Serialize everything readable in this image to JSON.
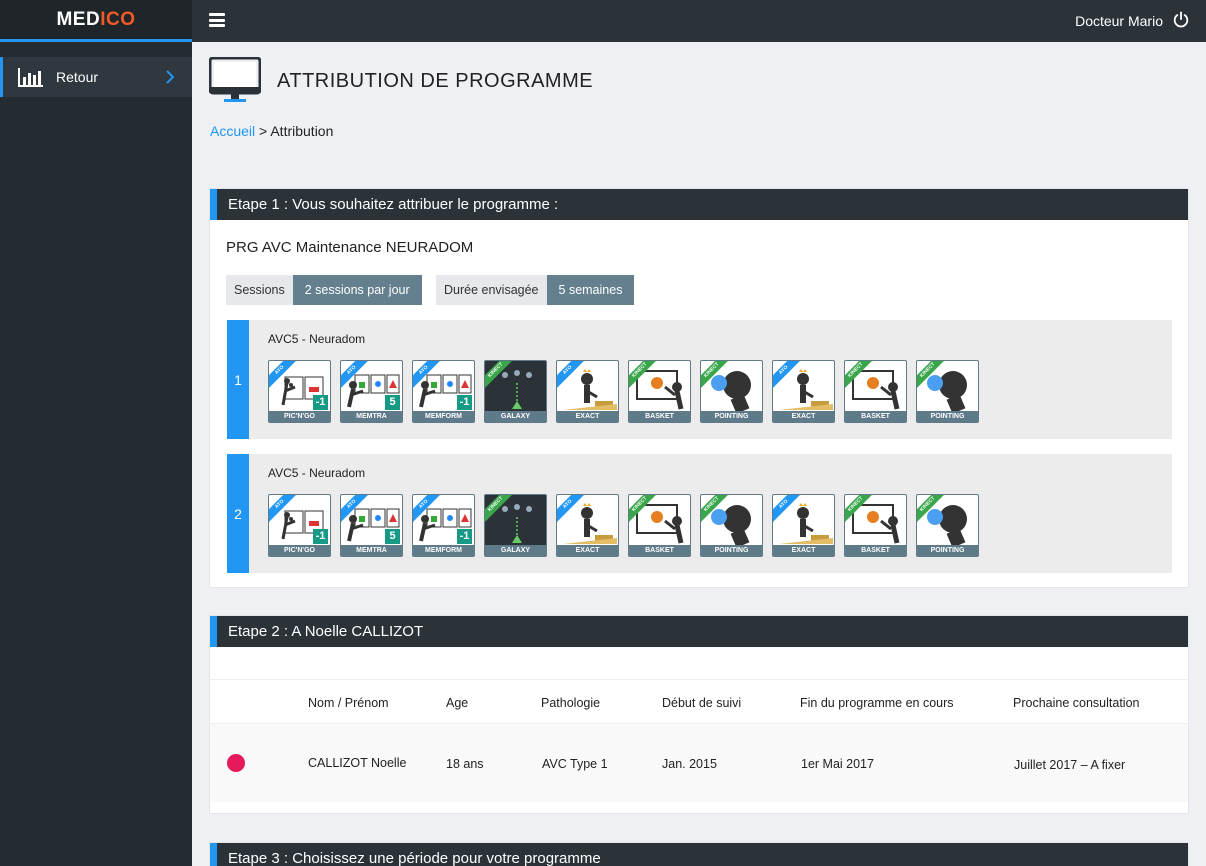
{
  "app": {
    "logo_main": "MED",
    "logo_accent": "ICO"
  },
  "header": {
    "user": "Docteur Mario"
  },
  "sidebar": {
    "items": [
      {
        "label": "Retour"
      }
    ]
  },
  "page": {
    "title": "ATTRIBUTION DE PROGRAMME",
    "breadcrumb": {
      "home": "Accueil",
      "separator": ">",
      "current": "Attribution"
    }
  },
  "step1": {
    "title": "Etape 1 : Vous souhaitez attribuer le programme :",
    "program_name": "PRG AVC  Maintenance NEURADOM",
    "sessions_label": "Sessions",
    "sessions_value": "2 sessions par jour",
    "duration_label": "Durée envisagée",
    "duration_value": "5 semaines",
    "sessions": [
      {
        "number": "1",
        "title": "AVC5 - Neuradom"
      },
      {
        "number": "2",
        "title": "AVC5 - Neuradom"
      }
    ],
    "activities": [
      {
        "name": "PIC'N'GO",
        "tag": "AYO",
        "badge": "-1",
        "icon": "picngo-icon"
      },
      {
        "name": "MEMTRA",
        "tag": "AYO",
        "badge": "5",
        "icon": "memtra-icon"
      },
      {
        "name": "MEMFORM",
        "tag": "AYO",
        "badge": "-1",
        "icon": "memform-icon"
      },
      {
        "name": "GALAXY",
        "tag": "KINECT",
        "badge": "",
        "icon": "galaxy-icon"
      },
      {
        "name": "EXACT",
        "tag": "AYO",
        "badge": "",
        "icon": "exact-icon"
      },
      {
        "name": "BASKET",
        "tag": "KINECT",
        "badge": "",
        "icon": "basket-icon"
      },
      {
        "name": "POINTING",
        "tag": "KINECT",
        "badge": "",
        "icon": "pointing-icon"
      },
      {
        "name": "EXACT",
        "tag": "AYO",
        "badge": "",
        "icon": "exact-icon"
      },
      {
        "name": "BASKET",
        "tag": "KINECT",
        "badge": "",
        "icon": "basket-icon"
      },
      {
        "name": "POINTING",
        "tag": "KINECT",
        "badge": "",
        "icon": "pointing-icon"
      }
    ]
  },
  "step2": {
    "title": "Etape 2 : A Noelle CALLIZOT",
    "columns": [
      "Nom / Prénom",
      "Age",
      "Pathologie",
      "Début de suivi",
      "Fin du programme en cours",
      "Prochaine consultation"
    ],
    "row": [
      "CALLIZOT Noelle",
      "18 ans",
      "AVC Type 1",
      "Jan. 2015",
      "1er Mai 2017",
      "Juillet 2017 – A fixer"
    ],
    "status_color": "#e6195a"
  },
  "step3": {
    "title": "Etape 3 : Choisissez une période pour votre programme"
  },
  "colors": {
    "accent": "#2196f3",
    "dark": "#2b3338",
    "pill": "#64808f",
    "logo_accent": "#f15a24"
  }
}
